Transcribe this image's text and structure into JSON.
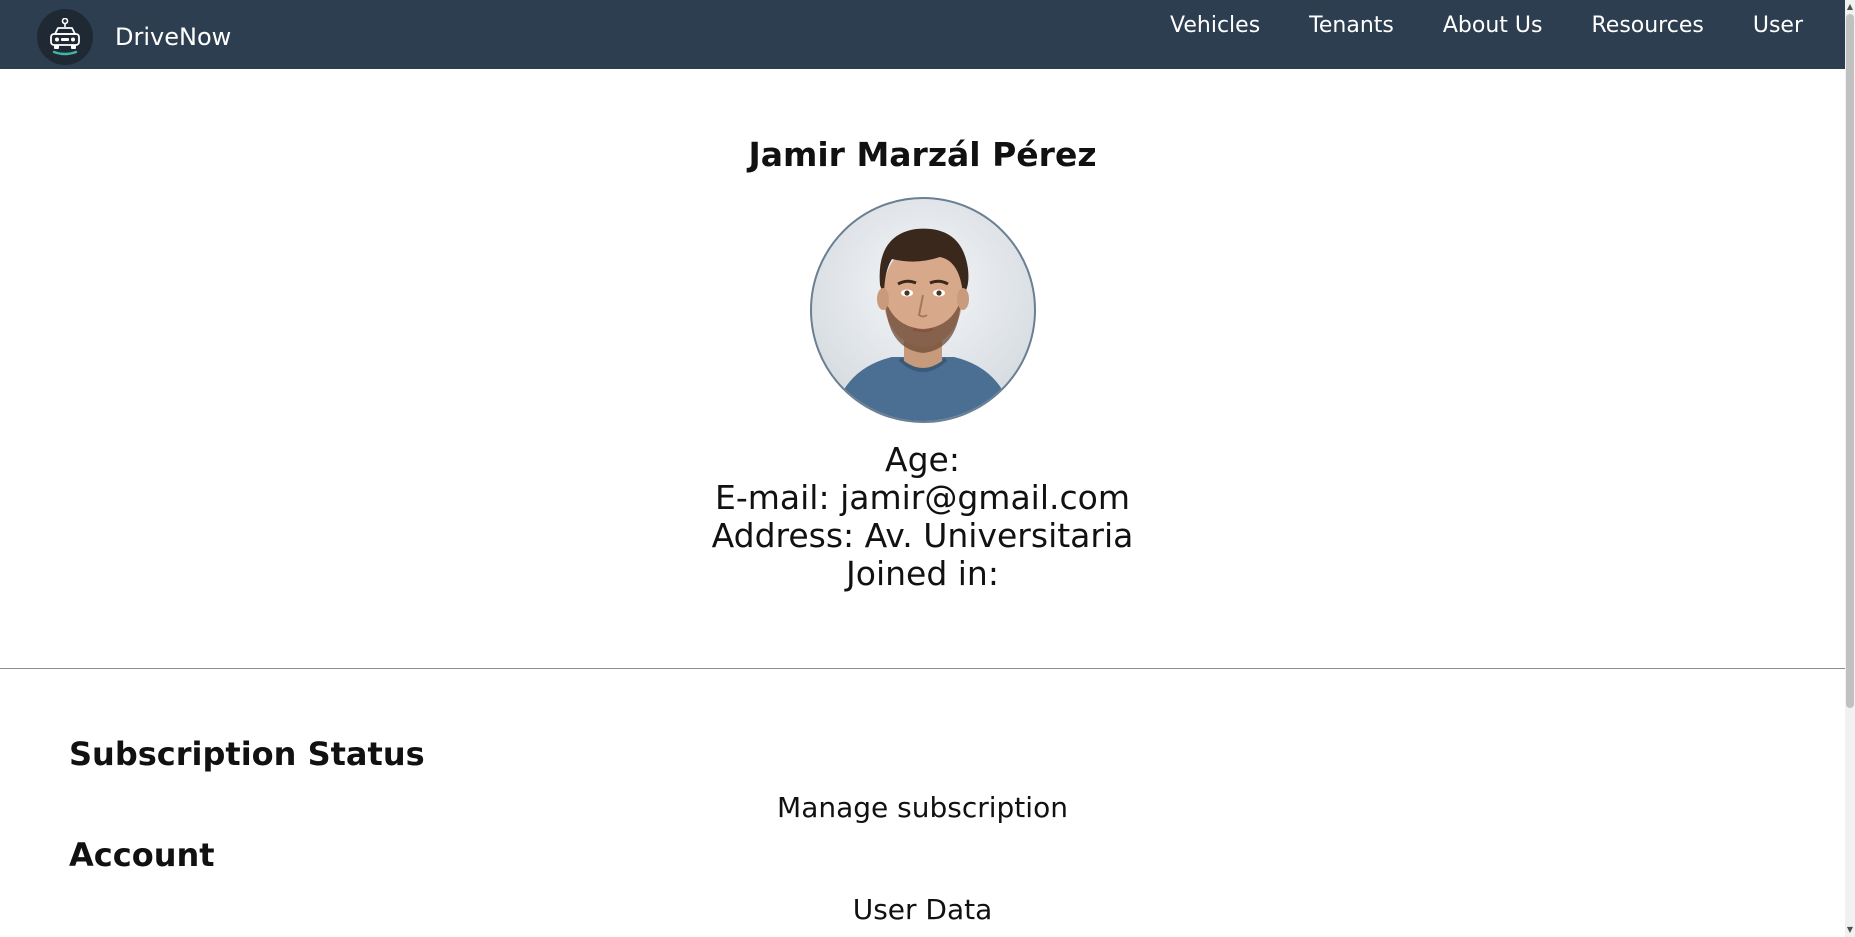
{
  "brand": {
    "name": "DriveNow",
    "logo_icon": "car-robot-icon"
  },
  "nav": {
    "items": [
      {
        "label": "Vehicles"
      },
      {
        "label": "Tenants"
      },
      {
        "label": "About Us"
      },
      {
        "label": "Resources"
      },
      {
        "label": "User"
      }
    ]
  },
  "profile": {
    "name": "Jamir Marzál Pérez",
    "avatar_icon": "user-avatar-photo",
    "age_line": "Age:",
    "email_line": "E-mail: jamir@gmail.com",
    "address_line": "Address: Av. Universitaria",
    "joined_line": "Joined in:"
  },
  "subscription": {
    "title": "Subscription Status",
    "link": "Manage subscription"
  },
  "account": {
    "title": "Account",
    "link": "User Data"
  },
  "colors": {
    "navbar": "#2c3e50",
    "text": "#111111",
    "background": "#ffffff"
  }
}
